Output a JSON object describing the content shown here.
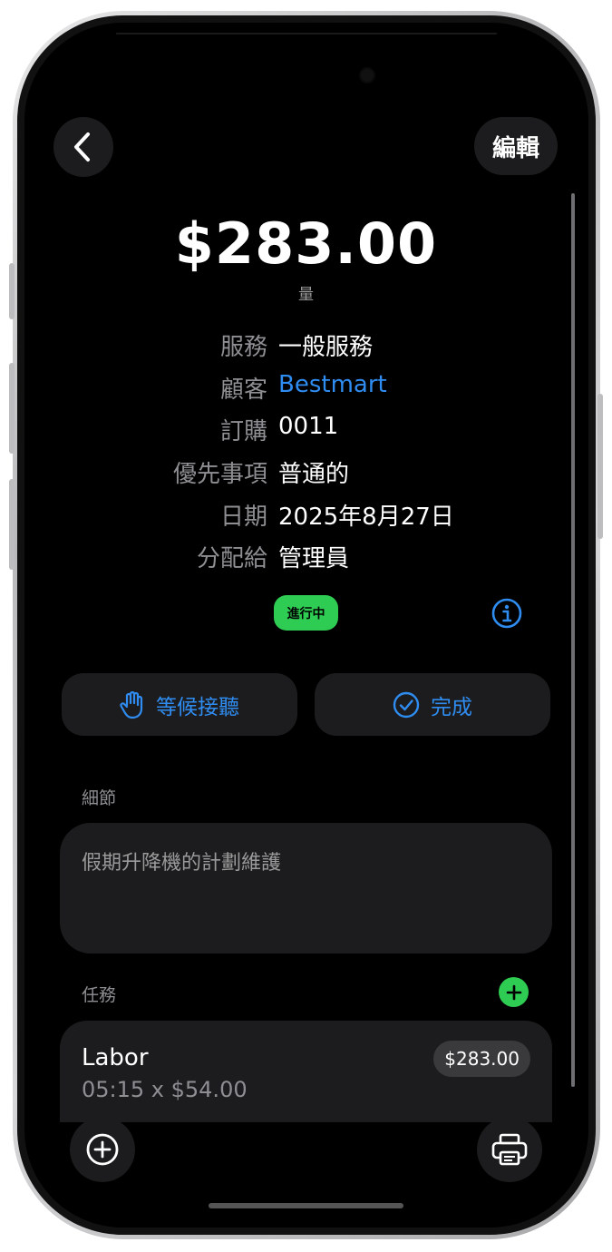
{
  "header": {
    "edit_label": "編輯"
  },
  "summary": {
    "amount": "$283.00",
    "amount_caption": "量"
  },
  "info": [
    {
      "label": "服務",
      "value": "一般服務"
    },
    {
      "label": "顧客",
      "value": "Bestmart"
    },
    {
      "label": "訂購",
      "value": "0011"
    },
    {
      "label": "優先事項",
      "value": "普通的"
    },
    {
      "label": "日期",
      "value": "2025年8月27日"
    },
    {
      "label": "分配給",
      "value": "管理員"
    }
  ],
  "status": {
    "label": "進行中",
    "color": "#2ecc52"
  },
  "actions": {
    "hold_label": "等候接聽",
    "complete_label": "完成"
  },
  "details": {
    "section_label": "細節",
    "text": "假期升降機的計劃維護"
  },
  "tasks": {
    "section_label": "任務",
    "items": [
      {
        "title": "Labor",
        "subtitle": "05:15 x $54.00",
        "price": "$283.00"
      }
    ]
  },
  "colors": {
    "accent": "#2f8cf0",
    "green": "#2ecc52",
    "background": "#000000",
    "card": "#1c1c1e"
  }
}
